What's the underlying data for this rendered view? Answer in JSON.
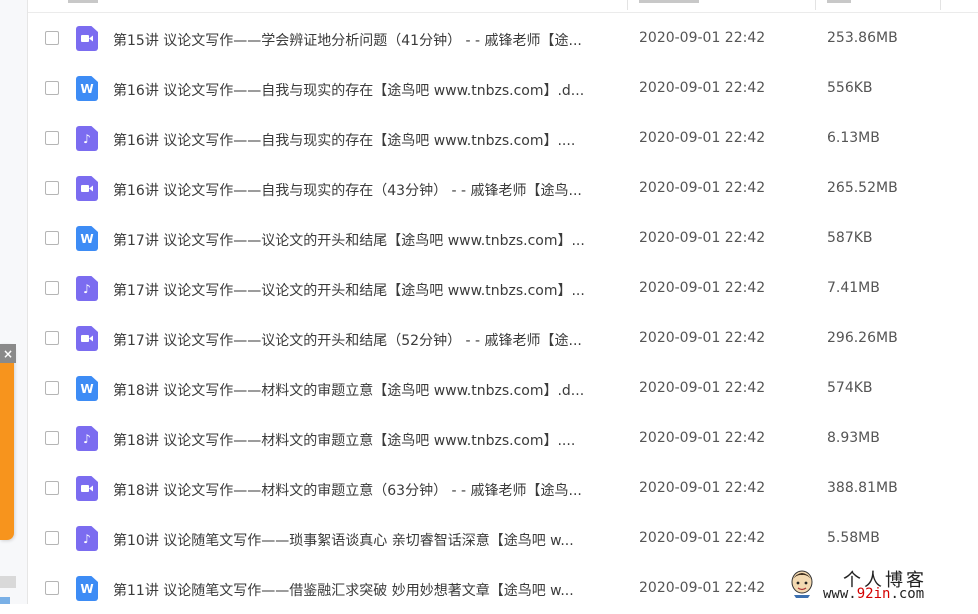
{
  "rows": [
    {
      "icon": "video",
      "name": "第15讲 议论文写作——学会辨证地分析问题（41分钟） - - 戚锋老师【途...",
      "date": "2020-09-01 22:42",
      "size": "253.86MB"
    },
    {
      "icon": "word",
      "name": "第16讲 议论文写作——自我与现实的存在【途鸟吧 www.tnbzs.com】.d...",
      "date": "2020-09-01 22:42",
      "size": "556KB"
    },
    {
      "icon": "audio",
      "name": "第16讲 议论文写作——自我与现实的存在【途鸟吧 www.tnbzs.com】....",
      "date": "2020-09-01 22:42",
      "size": "6.13MB"
    },
    {
      "icon": "video",
      "name": "第16讲 议论文写作——自我与现实的存在（43分钟） - - 戚锋老师【途鸟...",
      "date": "2020-09-01 22:42",
      "size": "265.52MB"
    },
    {
      "icon": "word",
      "name": "第17讲 议论文写作——议论文的开头和结尾【途鸟吧 www.tnbzs.com】...",
      "date": "2020-09-01 22:42",
      "size": "587KB"
    },
    {
      "icon": "audio",
      "name": "第17讲 议论文写作——议论文的开头和结尾【途鸟吧 www.tnbzs.com】...",
      "date": "2020-09-01 22:42",
      "size": "7.41MB"
    },
    {
      "icon": "video",
      "name": "第17讲 议论文写作——议论文的开头和结尾（52分钟） - - 戚锋老师【途...",
      "date": "2020-09-01 22:42",
      "size": "296.26MB"
    },
    {
      "icon": "word",
      "name": "第18讲 议论文写作——材料文的审题立意【途鸟吧 www.tnbzs.com】.d...",
      "date": "2020-09-01 22:42",
      "size": "574KB"
    },
    {
      "icon": "audio",
      "name": "第18讲 议论文写作——材料文的审题立意【途鸟吧 www.tnbzs.com】....",
      "date": "2020-09-01 22:42",
      "size": "8.93MB"
    },
    {
      "icon": "video",
      "name": "第18讲 议论文写作——材料文的审题立意（63分钟） - - 戚锋老师【途鸟...",
      "date": "2020-09-01 22:42",
      "size": "388.81MB"
    },
    {
      "icon": "audio",
      "name": "第10讲 议论随笔文写作——琐事絮语谈真心 亲切睿智话深意【途鸟吧 w...",
      "date": "2020-09-01 22:42",
      "size": "5.58MB"
    },
    {
      "icon": "word",
      "name": "第11讲 议论随笔文写作——借鉴融汇求突破 妙用妙想著文章【途鸟吧 w...",
      "date": "2020-09-01 22:42",
      "size": ""
    }
  ],
  "promo": {
    "close_label": "×"
  },
  "watermark": {
    "title": "个人博客",
    "url_prefix": "www.",
    "url_red": "92in",
    "url_suffix": ".com"
  },
  "icons": {
    "video": "video-file-icon",
    "word": "word-file-icon",
    "audio": "audio-file-icon"
  },
  "colors": {
    "video": "#7b6cf0",
    "audio": "#7b6cf0",
    "word": "#3d8cf5",
    "promo": "#f7941d"
  }
}
